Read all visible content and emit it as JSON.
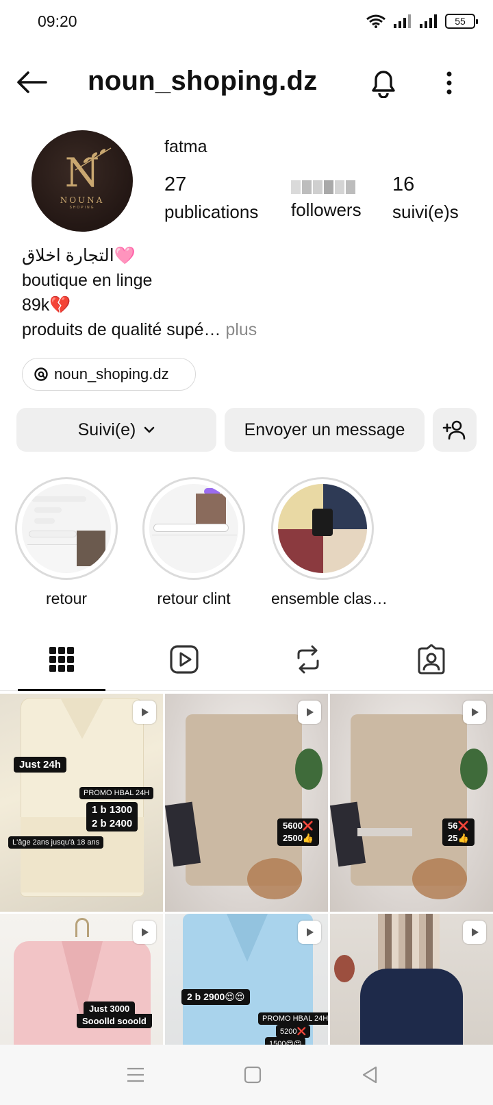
{
  "status_bar": {
    "time": "09:20",
    "battery": "55"
  },
  "header": {
    "title": "noun_shoping.dz"
  },
  "profile": {
    "name": "fatma",
    "avatar_letter": "N",
    "avatar_brand": "NOUNA",
    "avatar_sub": "SHOPING",
    "stats": {
      "posts_count": "27",
      "posts_label": "publications",
      "followers_label": "followers",
      "following_count": "16",
      "following_label": "suivi(e)s"
    }
  },
  "bio": {
    "line1": "التجارة اخلاق🩷",
    "line2": "boutique en linge",
    "line3": "89k💔",
    "line4": "produits de qualité supé…",
    "more": " plus"
  },
  "threads": {
    "handle": "noun_shoping.dz"
  },
  "actions": {
    "follow_label": "Suivi(e)",
    "message_label": "Envoyer un message"
  },
  "highlights": [
    {
      "label": "retour"
    },
    {
      "label": "retour clint"
    },
    {
      "label": "ensemble clas…"
    }
  ],
  "posts": [
    {
      "tags": [
        "Just 24h",
        "PROMO HBAL 24H",
        "1 b 1300",
        "2 b 2400",
        "L'âge 2ans jusqu'à 18 ans"
      ]
    },
    {
      "tags": [
        "5600❌",
        "2500👍"
      ]
    },
    {
      "tags": [
        "56❌",
        "25👍"
      ]
    },
    {
      "tags": [
        "Just 3000",
        "Sooolld sooold"
      ]
    },
    {
      "tags": [
        "2 b 2900😍😍",
        "PROMO HBAL 24H",
        "5200❌",
        "1500😍😍"
      ]
    },
    {
      "tags": []
    }
  ],
  "colors": {
    "accent_button_bg": "#efefef",
    "text": "#111111",
    "muted": "#8a8a8a",
    "avatar_bg": "#231714",
    "avatar_gold": "#c9a770"
  }
}
